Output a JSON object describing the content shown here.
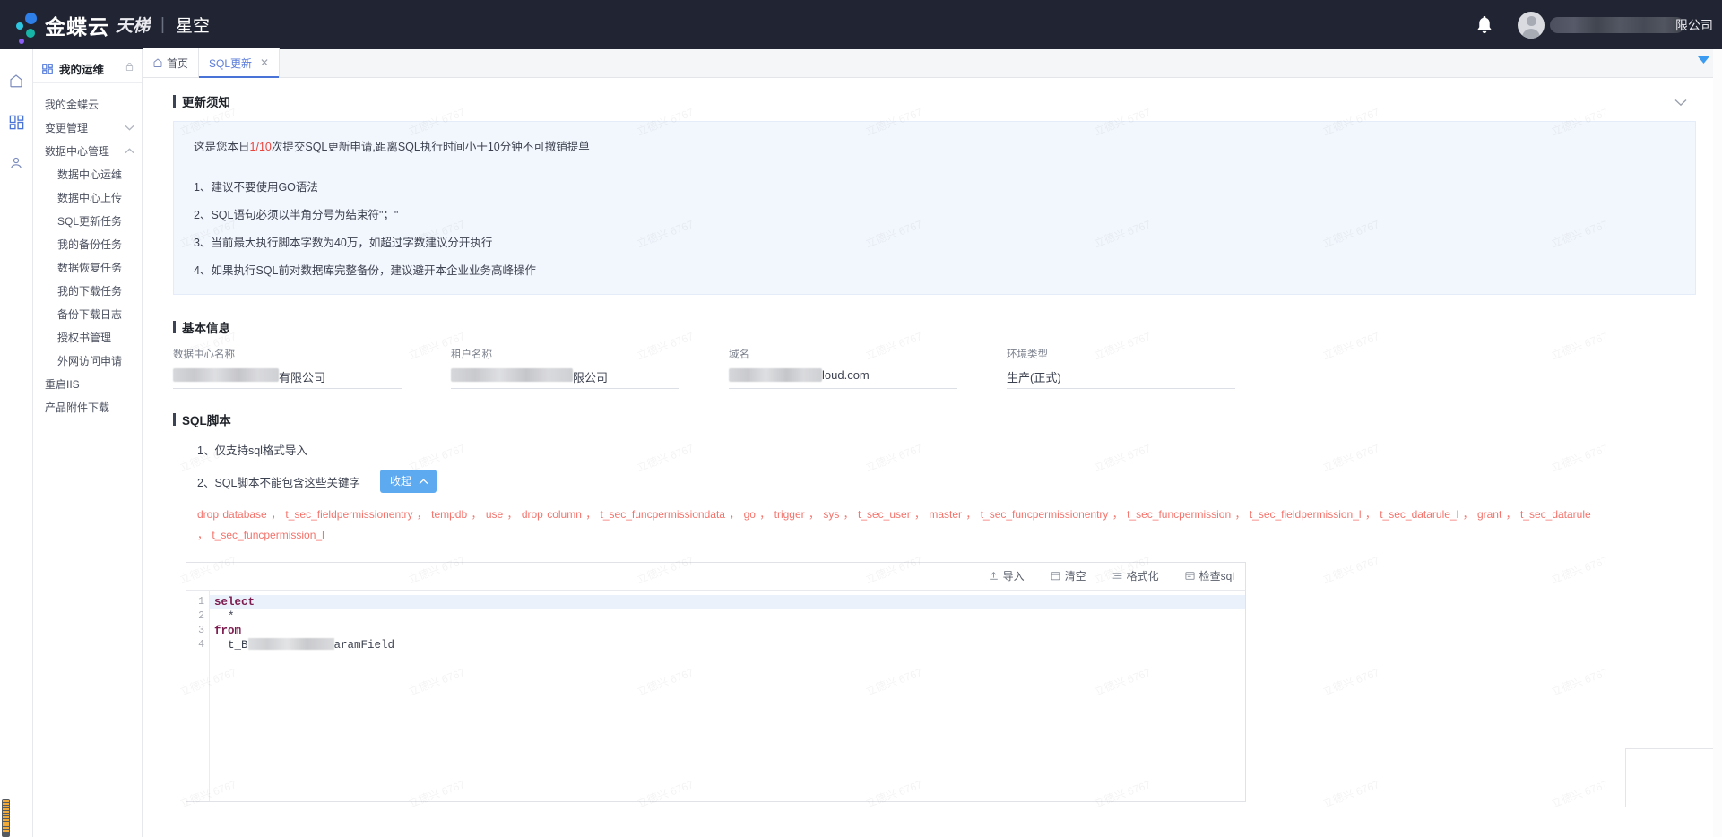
{
  "header": {
    "brand_main": "金蝶云",
    "brand_sub": "天梯",
    "brand_separator": "|",
    "brand_product": "星空",
    "bell_icon": "bell-icon",
    "avatar_icon": "avatar-icon",
    "username_redacted": true,
    "username_tail": "限公司"
  },
  "rail": {
    "items": [
      {
        "icon": "home-icon",
        "name": "home",
        "active": false
      },
      {
        "icon": "grid-icon",
        "name": "apps",
        "active": true
      },
      {
        "icon": "user-icon",
        "name": "profile",
        "active": false
      }
    ]
  },
  "sidebar": {
    "title": "我的运维",
    "title_icon": "grid-icon",
    "lock_icon": "lock-icon",
    "items": [
      {
        "label": "我的金蝶云",
        "level": 1,
        "chevron": ""
      },
      {
        "label": "变更管理",
        "level": 1,
        "chevron": "down"
      },
      {
        "label": "数据中心管理",
        "level": 1,
        "chevron": "up"
      },
      {
        "label": "数据中心运维",
        "level": 2,
        "chevron": ""
      },
      {
        "label": "数据中心上传",
        "level": 2,
        "chevron": ""
      },
      {
        "label": "SQL更新任务",
        "level": 2,
        "chevron": ""
      },
      {
        "label": "我的备份任务",
        "level": 2,
        "chevron": ""
      },
      {
        "label": "数据恢复任务",
        "level": 2,
        "chevron": ""
      },
      {
        "label": "我的下载任务",
        "level": 2,
        "chevron": ""
      },
      {
        "label": "备份下载日志",
        "level": 2,
        "chevron": ""
      },
      {
        "label": "授权书管理",
        "level": 2,
        "chevron": ""
      },
      {
        "label": "外网访问申请",
        "level": 2,
        "chevron": ""
      },
      {
        "label": "重启IIS",
        "level": 1,
        "chevron": ""
      },
      {
        "label": "产品附件下载",
        "level": 1,
        "chevron": ""
      }
    ]
  },
  "tabs": {
    "items": [
      {
        "label": "首页",
        "icon": "home-icon",
        "closable": false,
        "active": false
      },
      {
        "label": "SQL更新",
        "icon": "",
        "closable": true,
        "active": true
      }
    ],
    "close_glyph": "✕",
    "overflow_caret": "caret-down-icon"
  },
  "notice": {
    "section_title": "更新须知",
    "collapse_icon": "chevron-down-icon",
    "lead_prefix": "这是您本日",
    "lead_highlight": "1/10",
    "lead_suffix": "次提交SQL更新申请,距离SQL执行时间小于10分钟不可撤销提单",
    "items": [
      "1、建议不要使用GO语法",
      "2、SQL语句必须以半角分号为结束符\"；\"",
      "3、当前最大执行脚本字数为40万，如超过字数建议分开执行",
      "4、如果执行SQL前对数据库完整备份，建议避开本企业业务高峰操作"
    ]
  },
  "basic_info": {
    "section_title": "基本信息",
    "fields": [
      {
        "label": "数据中心名称",
        "value_redacted": true,
        "value_tail": "有限公司",
        "blur_width": 118
      },
      {
        "label": "租户名称",
        "value_redacted": true,
        "value_tail": "限公司",
        "blur_width": 136
      },
      {
        "label": "域名",
        "value_redacted": true,
        "value_tail": "loud.com",
        "blur_width": 104
      },
      {
        "label": "环境类型",
        "value_redacted": false,
        "value_tail": "生产(正式)",
        "blur_width": 0
      }
    ]
  },
  "sql_script": {
    "section_title": "SQL脚本",
    "rules": [
      {
        "text": "1、仅支持sql格式导入",
        "has_button": false
      },
      {
        "text": "2、SQL脚本不能包含这些关键字",
        "has_button": true
      }
    ],
    "collapse_button_label": "收起",
    "collapse_button_icon": "chevron-up-icon",
    "forbidden_keywords": [
      "drop database",
      "t_sec_fieldpermissionentry",
      "tempdb",
      "use",
      "drop column",
      "t_sec_funcpermissiondata",
      "go",
      "trigger",
      "sys",
      "t_sec_user",
      "master",
      "t_sec_funcpermissionentry",
      "t_sec_funcpermission",
      "t_sec_fieldpermission_l",
      "t_sec_datarule_l",
      "grant",
      "t_sec_datarule",
      "t_sec_funcpermission_l"
    ],
    "keyword_separator": " ， ",
    "toolbar": [
      {
        "label": "导入",
        "icon": "upload-icon"
      },
      {
        "label": "清空",
        "icon": "trash-icon"
      },
      {
        "label": "格式化",
        "icon": "lines-icon"
      },
      {
        "label": "检查sql",
        "icon": "check-sql-icon"
      }
    ],
    "editor": {
      "lines": [
        {
          "num": "1",
          "tokens": [
            {
              "t": "select",
              "kind": "keyword"
            }
          ],
          "highlighted": true
        },
        {
          "num": "2",
          "tokens": [
            {
              "t": "  *",
              "kind": "plain"
            }
          ],
          "highlighted": false
        },
        {
          "num": "3",
          "tokens": [
            {
              "t": "from",
              "kind": "keyword"
            }
          ],
          "highlighted": false
        },
        {
          "num": "4",
          "tokens": [
            {
              "t": "  t_B",
              "kind": "plain"
            },
            {
              "t": "",
              "kind": "redacted"
            },
            {
              "t": "aramField",
              "kind": "plain"
            }
          ],
          "highlighted": false
        }
      ]
    }
  },
  "colors": {
    "header_bg": "#212533",
    "accent": "#4a73d8",
    "notice_bg": "#f2f6fd",
    "danger": "#e8453c",
    "keyword_red": "#f4736c",
    "button_blue": "#5eaaf0",
    "sql_keyword": "#7b1b4e"
  },
  "watermark": {
    "text": "立德兴 6767"
  }
}
